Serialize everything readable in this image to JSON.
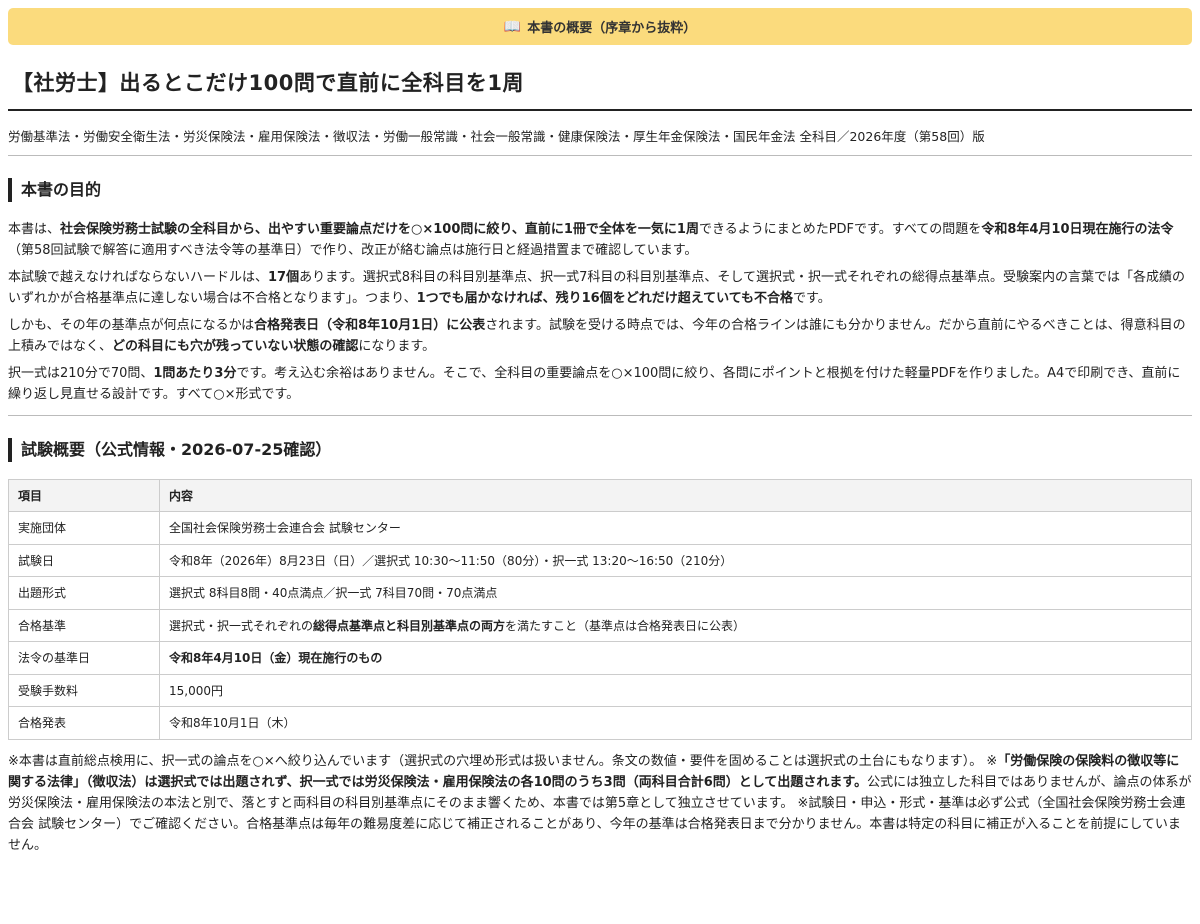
{
  "banner": {
    "icon": "open-book-icon",
    "text": "本書の概要（序章から抜粋）"
  },
  "title": "【社労士】出るとこだけ100問で直前に全科目を1周",
  "subtitle": "労働基準法・労働安全衛生法・労災保険法・雇用保険法・徴収法・労働一般常識・社会一般常識・健康保険法・厚生年金保険法・国民年金法 全科目／2026年度（第58回）版",
  "purpose": {
    "heading": "本書の目的",
    "paragraphs": [
      [
        {
          "t": "本書は、",
          "b": false
        },
        {
          "t": "社会保険労務士試験の全科目から、出やすい重要論点だけを○×100問に絞り、直前に1冊で全体を一気に1周",
          "b": true
        },
        {
          "t": "できるようにまとめたPDFです。すべての問題を",
          "b": false
        },
        {
          "t": "令和8年4月10日現在施行の法令",
          "b": true
        },
        {
          "t": "（第58回試験で解答に適用すべき法令等の基準日）で作り、改正が絡む論点は施行日と経過措置まで確認しています。",
          "b": false
        }
      ],
      [
        {
          "t": "本試験で越えなければならないハードルは、",
          "b": false
        },
        {
          "t": "17個",
          "b": true
        },
        {
          "t": "あります。選択式8科目の科目別基準点、択一式7科目の科目別基準点、そして選択式・択一式それぞれの総得点基準点。受験案内の言葉では「各成績のいずれかが合格基準点に達しない場合は不合格となります」。つまり、",
          "b": false
        },
        {
          "t": "1つでも届かなければ、残り16個をどれだけ超えていても不合格",
          "b": true
        },
        {
          "t": "です。",
          "b": false
        }
      ],
      [
        {
          "t": "しかも、その年の基準点が何点になるかは",
          "b": false
        },
        {
          "t": "合格発表日（令和8年10月1日）に公表",
          "b": true
        },
        {
          "t": "されます。試験を受ける時点では、今年の合格ラインは誰にも分かりません。だから直前にやるべきことは、得意科目の上積みではなく、",
          "b": false
        },
        {
          "t": "どの科目にも穴が残っていない状態の確認",
          "b": true
        },
        {
          "t": "になります。",
          "b": false
        }
      ],
      [
        {
          "t": "択一式は210分で70問、",
          "b": false
        },
        {
          "t": "1問あたり3分",
          "b": true
        },
        {
          "t": "です。考え込む余裕はありません。そこで、全科目の重要論点を○×100問に絞り、各問にポイントと根拠を付けた軽量PDFを作りました。A4で印刷でき、直前に繰り返し見直せる設計です。すべて○×形式です。",
          "b": false
        }
      ]
    ]
  },
  "exam": {
    "heading": "試験概要（公式情報・2026-07-25確認）",
    "columns": [
      "項目",
      "内容"
    ],
    "rows": [
      {
        "key": "実施団体",
        "value": [
          {
            "t": "全国社会保険労務士会連合会 試験センター",
            "b": false
          }
        ]
      },
      {
        "key": "試験日",
        "value": [
          {
            "t": "令和8年（2026年）8月23日（日）／選択式 10:30〜11:50（80分）・択一式 13:20〜16:50（210分）",
            "b": false
          }
        ]
      },
      {
        "key": "出題形式",
        "value": [
          {
            "t": "選択式 8科目8問・40点満点／択一式 7科目70問・70点満点",
            "b": false
          }
        ]
      },
      {
        "key": "合格基準",
        "value": [
          {
            "t": "選択式・択一式それぞれの",
            "b": false
          },
          {
            "t": "総得点基準点と科目別基準点の両方",
            "b": true
          },
          {
            "t": "を満たすこと（基準点は合格発表日に公表）",
            "b": false
          }
        ]
      },
      {
        "key": "法令の基準日",
        "value": [
          {
            "t": "令和8年4月10日（金）現在施行のもの",
            "b": true
          }
        ]
      },
      {
        "key": "受験手数料",
        "value": [
          {
            "t": "15,000円",
            "b": false
          }
        ]
      },
      {
        "key": "合格発表",
        "value": [
          {
            "t": "令和8年10月1日（木）",
            "b": false
          }
        ]
      }
    ]
  },
  "notes": [
    {
      "t": "※本書は直前総点検用に、択一式の論点を○×へ絞り込んでいます（選択式の穴埋め形式は扱いません。条文の数値・要件を固めることは選択式の土台にもなります）。 ※",
      "b": false
    },
    {
      "t": "「労働保険の保険料の徴収等に関する法律」（徴収法）は選択式では出題されず、択一式では労災保険法・雇用保険法の各10問のうち3問（両科目合計6問）として出題されます。",
      "b": true
    },
    {
      "t": "公式には独立した科目ではありませんが、論点の体系が労災保険法・雇用保険法の本法と別で、落とすと両科目の科目別基準点にそのまま響くため、本書では第5章として独立させています。 ※試験日・申込・形式・基準は必ず公式（全国社会保険労務士会連合会 試験センター）でご確認ください。合格基準点は毎年の難易度差に応じて補正されることがあり、今年の基準は合格発表日まで分かりません。本書は特定の科目に補正が入ることを前提にしていません。",
      "b": false
    }
  ]
}
